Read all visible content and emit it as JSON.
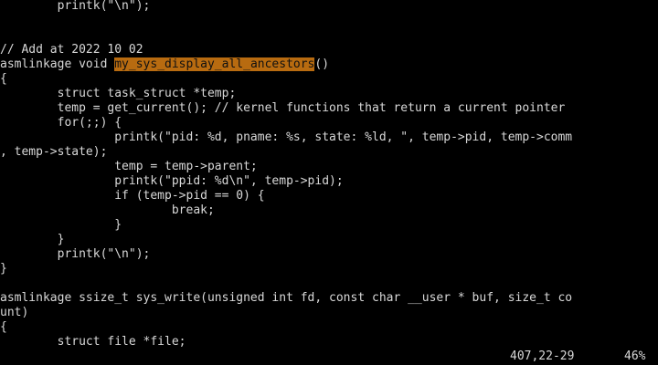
{
  "colors": {
    "background": "#000000",
    "text": "#d8d8d8",
    "search_highlight": "#b86b10"
  },
  "editor": {
    "lines": [
      "        printk(\"\\n\");",
      "",
      "// Add at 2022 10 02",
      {
        "before": "asmlinkage void ",
        "highlight": "my_sys_display_all_ancestors",
        "after": "()"
      },
      "{",
      "        struct task_struct *temp;",
      "        temp = get_current(); // kernel functions that return a current pointer",
      "        for(;;) {",
      "                printk(\"pid: %d, pname: %s, state: %ld, \", temp->pid, temp->comm",
      ", temp->state);",
      "                temp = temp->parent;",
      "                printk(\"ppid: %d\\n\", temp->pid);",
      "                if (temp->pid == 0) {",
      "                        break;",
      "                }",
      "        }",
      "        printk(\"\\n\");",
      "}",
      "",
      "asmlinkage ssize_t sys_write(unsigned int fd, const char __user * buf, size_t co",
      "unt)",
      "{",
      "        struct file *file;"
    ]
  },
  "statusline": {
    "position": "407,22-29",
    "percent": "46%"
  }
}
